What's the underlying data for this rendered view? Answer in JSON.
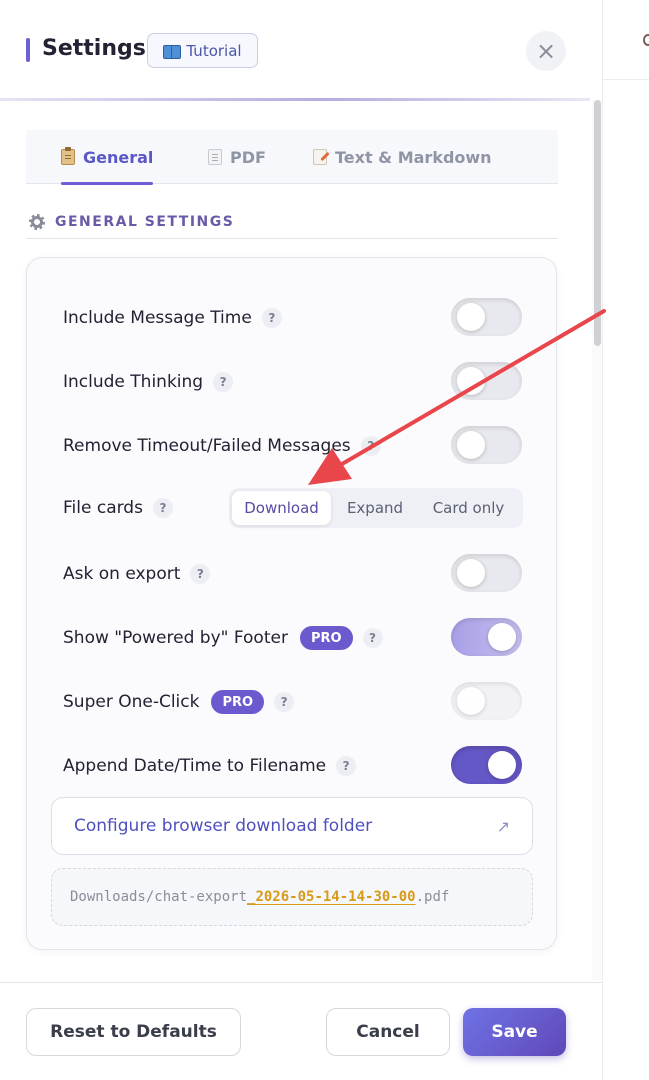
{
  "header": {
    "title": "Settings",
    "tutorial_label": "Tutorial",
    "close_glyph": "×"
  },
  "tabs": [
    {
      "label": "General",
      "icon": "clipboard-icon",
      "active": true
    },
    {
      "label": "PDF",
      "icon": "page-icon",
      "active": false
    },
    {
      "label": "Text & Markdown",
      "icon": "memo-icon",
      "active": false
    }
  ],
  "section": {
    "title": "GENERAL SETTINGS",
    "icon": "gear-icon"
  },
  "help_glyph": "?",
  "pro_label": "PRO",
  "settings": {
    "include_message_time": {
      "label": "Include Message Time",
      "enabled": false
    },
    "include_thinking": {
      "label": "Include Thinking",
      "enabled": false
    },
    "remove_failed": {
      "label": "Remove Timeout/Failed Messages",
      "enabled": false
    },
    "file_cards": {
      "label": "File cards",
      "options": [
        "Download",
        "Expand",
        "Card only"
      ],
      "selected": "Download"
    },
    "ask_on_export": {
      "label": "Ask on export",
      "enabled": false
    },
    "powered_by_footer": {
      "label": "Show \"Powered by\" Footer",
      "pro": true,
      "enabled": true
    },
    "super_one_click": {
      "label": "Super One-Click",
      "pro": true,
      "enabled": false,
      "disabled": true
    },
    "append_datetime": {
      "label": "Append Date/Time to Filename",
      "enabled": true
    }
  },
  "config_link": {
    "label": "Configure browser download folder",
    "icon_glyph": "↗"
  },
  "filename_preview": {
    "prefix": "Downloads/chat-export",
    "timestamp": "_2026-05-14-14-30-00",
    "extension": ".pdf"
  },
  "footer": {
    "reset_label": "Reset to Defaults",
    "cancel_label": "Cancel",
    "save_label": "Save"
  },
  "colors": {
    "accent": "#6d5fd6",
    "link": "#4f50c0",
    "timestamp": "#d79a19",
    "annotation_arrow": "#e8464b"
  }
}
